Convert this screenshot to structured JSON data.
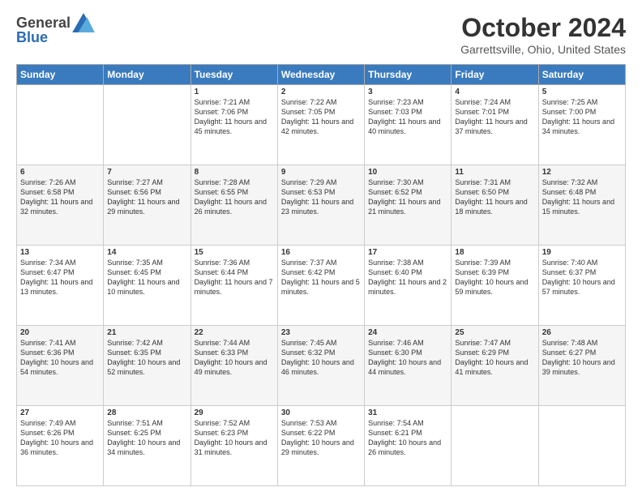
{
  "logo": {
    "general": "General",
    "blue": "Blue"
  },
  "header": {
    "month": "October 2024",
    "location": "Garrettsville, Ohio, United States"
  },
  "days_of_week": [
    "Sunday",
    "Monday",
    "Tuesday",
    "Wednesday",
    "Thursday",
    "Friday",
    "Saturday"
  ],
  "weeks": [
    [
      {
        "day": "",
        "info": ""
      },
      {
        "day": "",
        "info": ""
      },
      {
        "day": "1",
        "info": "Sunrise: 7:21 AM\nSunset: 7:06 PM\nDaylight: 11 hours and 45 minutes."
      },
      {
        "day": "2",
        "info": "Sunrise: 7:22 AM\nSunset: 7:05 PM\nDaylight: 11 hours and 42 minutes."
      },
      {
        "day": "3",
        "info": "Sunrise: 7:23 AM\nSunset: 7:03 PM\nDaylight: 11 hours and 40 minutes."
      },
      {
        "day": "4",
        "info": "Sunrise: 7:24 AM\nSunset: 7:01 PM\nDaylight: 11 hours and 37 minutes."
      },
      {
        "day": "5",
        "info": "Sunrise: 7:25 AM\nSunset: 7:00 PM\nDaylight: 11 hours and 34 minutes."
      }
    ],
    [
      {
        "day": "6",
        "info": "Sunrise: 7:26 AM\nSunset: 6:58 PM\nDaylight: 11 hours and 32 minutes."
      },
      {
        "day": "7",
        "info": "Sunrise: 7:27 AM\nSunset: 6:56 PM\nDaylight: 11 hours and 29 minutes."
      },
      {
        "day": "8",
        "info": "Sunrise: 7:28 AM\nSunset: 6:55 PM\nDaylight: 11 hours and 26 minutes."
      },
      {
        "day": "9",
        "info": "Sunrise: 7:29 AM\nSunset: 6:53 PM\nDaylight: 11 hours and 23 minutes."
      },
      {
        "day": "10",
        "info": "Sunrise: 7:30 AM\nSunset: 6:52 PM\nDaylight: 11 hours and 21 minutes."
      },
      {
        "day": "11",
        "info": "Sunrise: 7:31 AM\nSunset: 6:50 PM\nDaylight: 11 hours and 18 minutes."
      },
      {
        "day": "12",
        "info": "Sunrise: 7:32 AM\nSunset: 6:48 PM\nDaylight: 11 hours and 15 minutes."
      }
    ],
    [
      {
        "day": "13",
        "info": "Sunrise: 7:34 AM\nSunset: 6:47 PM\nDaylight: 11 hours and 13 minutes."
      },
      {
        "day": "14",
        "info": "Sunrise: 7:35 AM\nSunset: 6:45 PM\nDaylight: 11 hours and 10 minutes."
      },
      {
        "day": "15",
        "info": "Sunrise: 7:36 AM\nSunset: 6:44 PM\nDaylight: 11 hours and 7 minutes."
      },
      {
        "day": "16",
        "info": "Sunrise: 7:37 AM\nSunset: 6:42 PM\nDaylight: 11 hours and 5 minutes."
      },
      {
        "day": "17",
        "info": "Sunrise: 7:38 AM\nSunset: 6:40 PM\nDaylight: 11 hours and 2 minutes."
      },
      {
        "day": "18",
        "info": "Sunrise: 7:39 AM\nSunset: 6:39 PM\nDaylight: 10 hours and 59 minutes."
      },
      {
        "day": "19",
        "info": "Sunrise: 7:40 AM\nSunset: 6:37 PM\nDaylight: 10 hours and 57 minutes."
      }
    ],
    [
      {
        "day": "20",
        "info": "Sunrise: 7:41 AM\nSunset: 6:36 PM\nDaylight: 10 hours and 54 minutes."
      },
      {
        "day": "21",
        "info": "Sunrise: 7:42 AM\nSunset: 6:35 PM\nDaylight: 10 hours and 52 minutes."
      },
      {
        "day": "22",
        "info": "Sunrise: 7:44 AM\nSunset: 6:33 PM\nDaylight: 10 hours and 49 minutes."
      },
      {
        "day": "23",
        "info": "Sunrise: 7:45 AM\nSunset: 6:32 PM\nDaylight: 10 hours and 46 minutes."
      },
      {
        "day": "24",
        "info": "Sunrise: 7:46 AM\nSunset: 6:30 PM\nDaylight: 10 hours and 44 minutes."
      },
      {
        "day": "25",
        "info": "Sunrise: 7:47 AM\nSunset: 6:29 PM\nDaylight: 10 hours and 41 minutes."
      },
      {
        "day": "26",
        "info": "Sunrise: 7:48 AM\nSunset: 6:27 PM\nDaylight: 10 hours and 39 minutes."
      }
    ],
    [
      {
        "day": "27",
        "info": "Sunrise: 7:49 AM\nSunset: 6:26 PM\nDaylight: 10 hours and 36 minutes."
      },
      {
        "day": "28",
        "info": "Sunrise: 7:51 AM\nSunset: 6:25 PM\nDaylight: 10 hours and 34 minutes."
      },
      {
        "day": "29",
        "info": "Sunrise: 7:52 AM\nSunset: 6:23 PM\nDaylight: 10 hours and 31 minutes."
      },
      {
        "day": "30",
        "info": "Sunrise: 7:53 AM\nSunset: 6:22 PM\nDaylight: 10 hours and 29 minutes."
      },
      {
        "day": "31",
        "info": "Sunrise: 7:54 AM\nSunset: 6:21 PM\nDaylight: 10 hours and 26 minutes."
      },
      {
        "day": "",
        "info": ""
      },
      {
        "day": "",
        "info": ""
      }
    ]
  ]
}
